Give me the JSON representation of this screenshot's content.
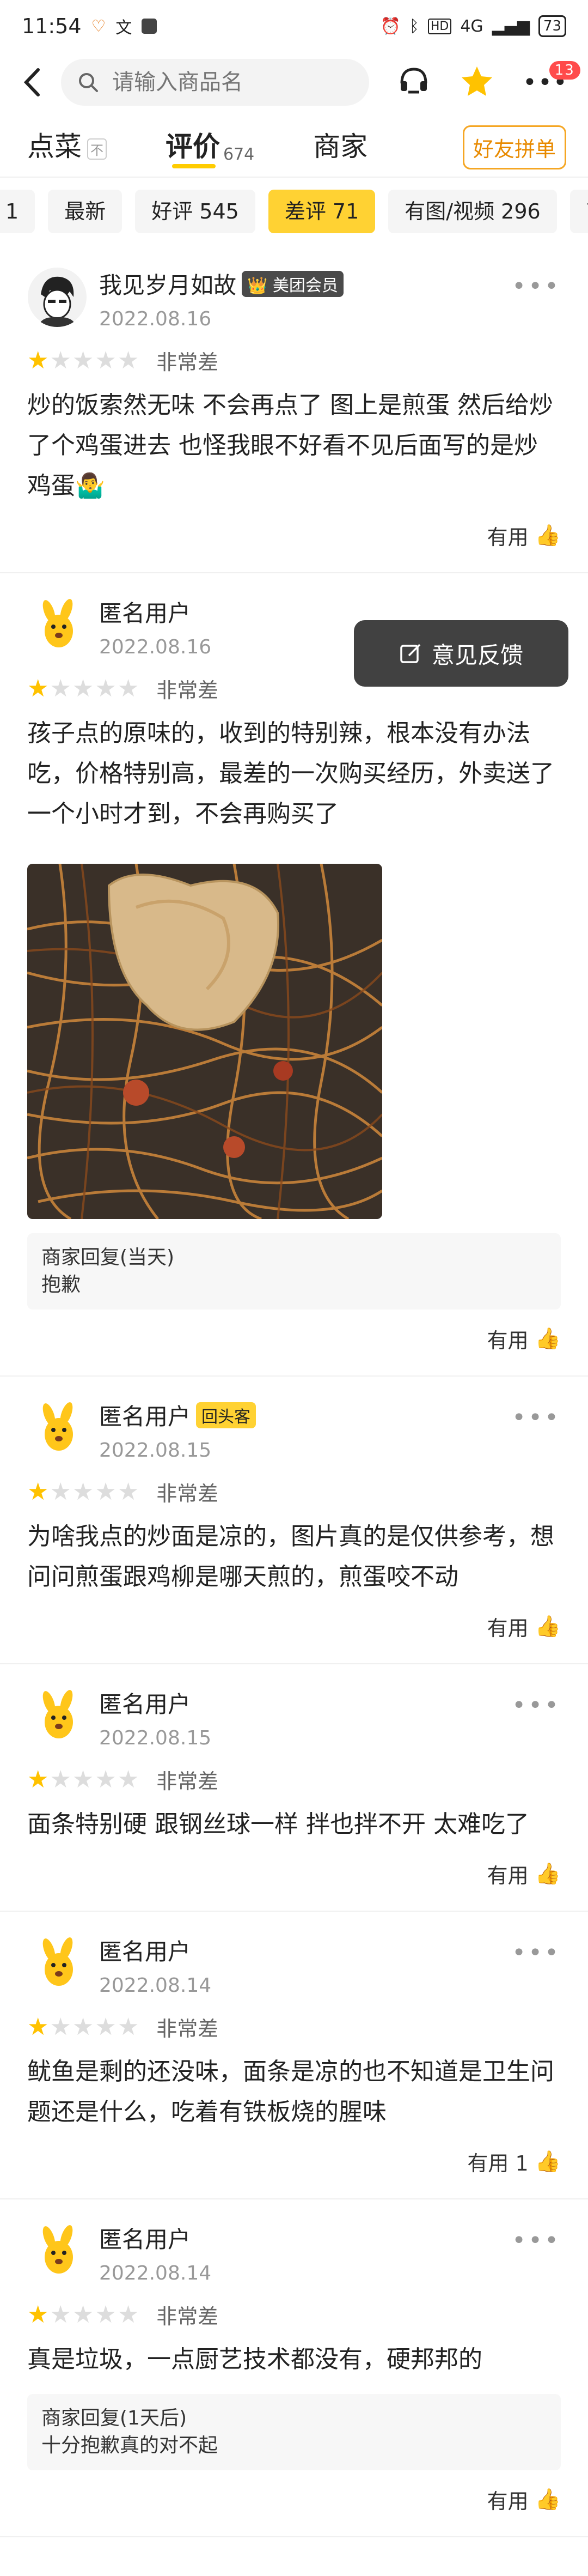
{
  "status": {
    "time": "11:54",
    "net": "4G",
    "battery": "73"
  },
  "search": {
    "placeholder": "请输入商品名"
  },
  "nav": {
    "badge": "13"
  },
  "tabs": [
    {
      "label": "点菜",
      "sub": "",
      "note": "不"
    },
    {
      "label": "评价",
      "sub": "674",
      "note": ""
    },
    {
      "label": "商家",
      "sub": "",
      "note": ""
    }
  ],
  "friend_order": "好友拼单",
  "chips": [
    "1",
    "最新",
    "好评 545",
    "差评 71",
    "有图/视频 296",
    "商家回"
  ],
  "feedback": "意见反馈",
  "reviews": [
    {
      "user": "我见岁月如故",
      "tag": "美团会员",
      "date": "2022.08.16",
      "rating_label": "非常差",
      "content": "炒的饭索然无味 不会再点了 图上是煎蛋 然后给炒了个鸡蛋进去 也怪我眼不好看不见后面写的是炒鸡蛋🤷‍♂️",
      "useful": "有用"
    },
    {
      "user": "匿名用户",
      "tag": "",
      "date": "2022.08.16",
      "rating_label": "非常差",
      "content": "孩子点的原味的，收到的特别辣，根本没有办法吃，价格特别高，最差的一次购买经历，外卖送了一个小时才到，不会再购买了",
      "reply_title": "商家回复(当天)",
      "reply_text": "抱歉",
      "useful": "有用"
    },
    {
      "user": "匿名用户",
      "tag": "回头客",
      "date": "2022.08.15",
      "rating_label": "非常差",
      "content": "为啥我点的炒面是凉的，图片真的是仅供参考，想问问煎蛋跟鸡柳是哪天煎的，煎蛋咬不动",
      "useful": "有用"
    },
    {
      "user": "匿名用户",
      "tag": "",
      "date": "2022.08.15",
      "rating_label": "非常差",
      "content": "面条特别硬 跟钢丝球一样 拌也拌不开 太难吃了",
      "useful": "有用"
    },
    {
      "user": "匿名用户",
      "tag": "",
      "date": "2022.08.14",
      "rating_label": "非常差",
      "content": "鱿鱼是剩的还没味，面条是凉的也不知道是卫生问题还是什么，吃着有铁板烧的腥味",
      "useful": "有用 1"
    },
    {
      "user": "匿名用户",
      "tag": "",
      "date": "2022.08.14",
      "rating_label": "非常差",
      "content": "真是垃圾，一点厨艺技术都没有，硬邦邦的",
      "reply_title": "商家回复(1天后)",
      "reply_text": "十分抱歉真的对不起",
      "useful": "有用"
    }
  ]
}
